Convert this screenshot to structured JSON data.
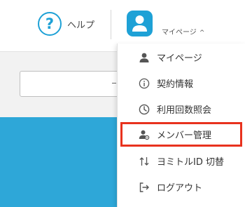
{
  "header": {
    "help_icon_glyph": "?",
    "help_label": "ヘルプ",
    "mypage_label": "マイページ",
    "mypage_caret": "^"
  },
  "menu": {
    "items": [
      {
        "label": "マイページ",
        "icon": "person-icon"
      },
      {
        "label": "契約情報",
        "icon": "info-icon"
      },
      {
        "label": "利用回数照会",
        "icon": "clock-icon"
      },
      {
        "label": "メンバー管理",
        "icon": "member-settings-icon",
        "highlighted": true
      },
      {
        "label": "ヨミトルID 切替",
        "icon": "switch-arrows-icon"
      },
      {
        "label": "ログアウト",
        "icon": "logout-icon"
      }
    ]
  },
  "colors": {
    "accent": "#1ea1d6",
    "band": "#2ea7d8",
    "highlight_border": "#e8321e"
  }
}
